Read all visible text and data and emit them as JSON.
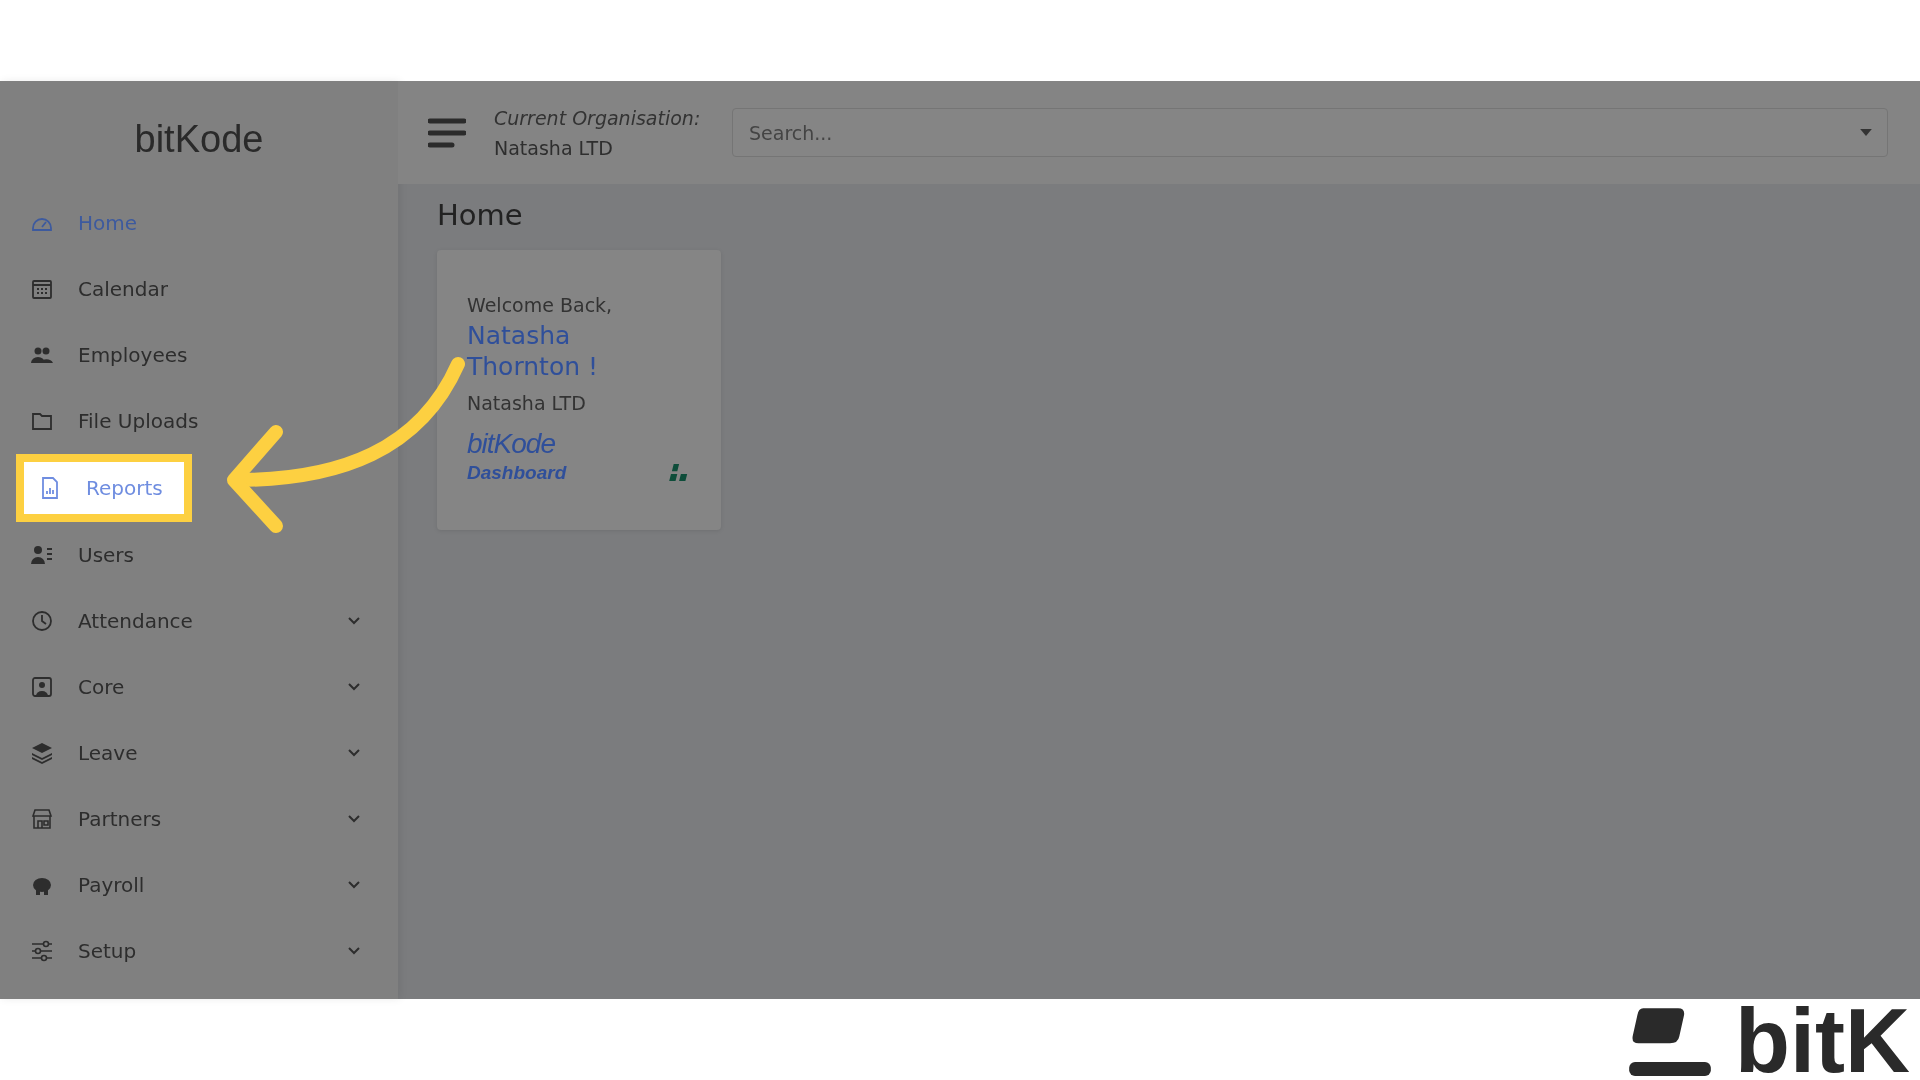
{
  "sidebar": {
    "logo": "bitKode",
    "items": [
      {
        "label": "Home",
        "selected": true,
        "highlighted": false,
        "expandable": false
      },
      {
        "label": "Calendar",
        "selected": false,
        "highlighted": false,
        "expandable": false
      },
      {
        "label": "Employees",
        "selected": false,
        "highlighted": false,
        "expandable": false
      },
      {
        "label": "File Uploads",
        "selected": false,
        "highlighted": false,
        "expandable": false
      },
      {
        "label": "Reports",
        "selected": false,
        "highlighted": true,
        "expandable": false
      },
      {
        "label": "Users",
        "selected": false,
        "highlighted": false,
        "expandable": false
      },
      {
        "label": "Attendance",
        "selected": false,
        "highlighted": false,
        "expandable": true
      },
      {
        "label": "Core",
        "selected": false,
        "highlighted": false,
        "expandable": true
      },
      {
        "label": "Leave",
        "selected": false,
        "highlighted": false,
        "expandable": true
      },
      {
        "label": "Partners",
        "selected": false,
        "highlighted": false,
        "expandable": true
      },
      {
        "label": "Payroll",
        "selected": false,
        "highlighted": false,
        "expandable": true
      },
      {
        "label": "Setup",
        "selected": false,
        "highlighted": false,
        "expandable": true
      }
    ]
  },
  "topbar": {
    "org_label": "Current Organisation:",
    "org_name": "Natasha LTD",
    "search": {
      "placeholder": "Search..."
    }
  },
  "page_title": "Home",
  "welcome_card": {
    "greeting": "Welcome Back,",
    "user_name": "Natasha Thornton !",
    "organisation": "Natasha LTD",
    "brand": "bitKode",
    "brand_subtitle": "Dashboard"
  },
  "footer_logo": "bitK"
}
